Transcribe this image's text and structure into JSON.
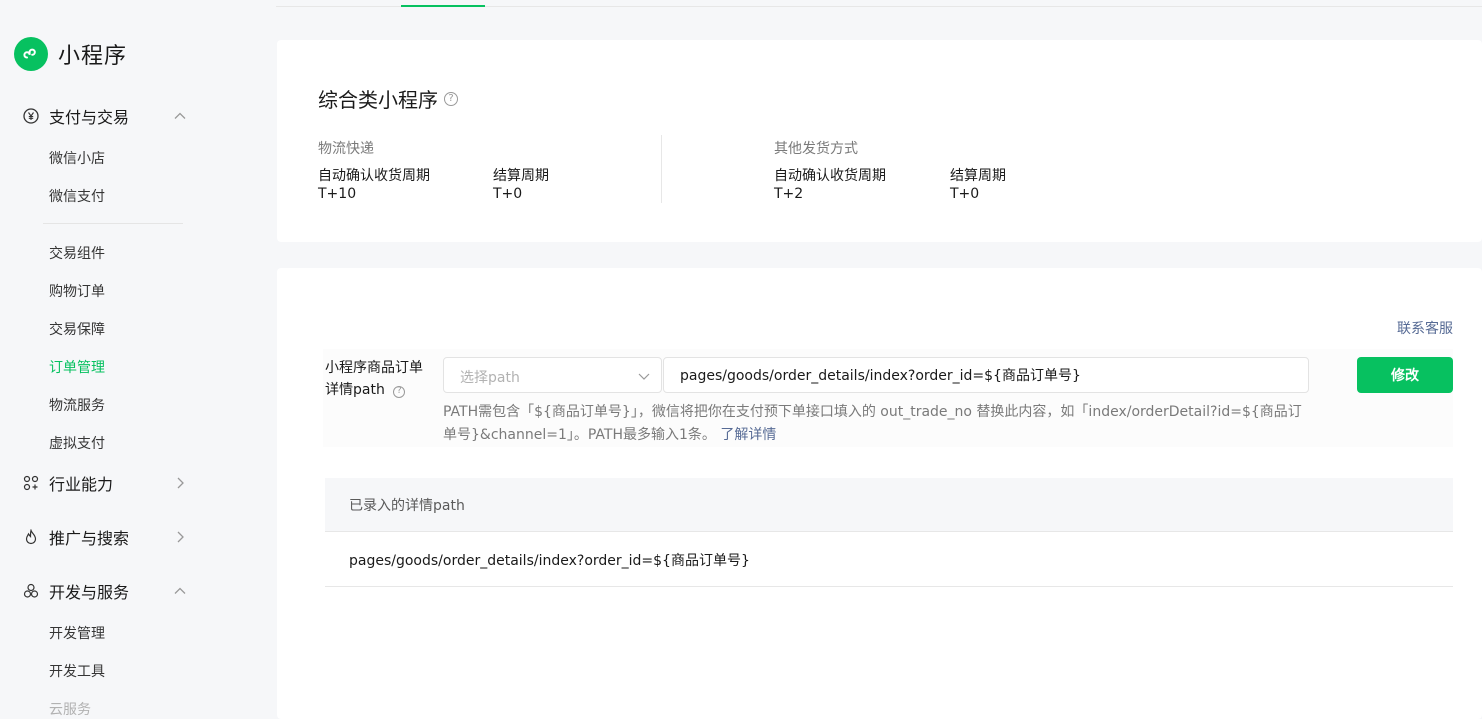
{
  "app": {
    "title": "小程序"
  },
  "sidebar": {
    "groups": [
      {
        "label": "支付与交易",
        "expanded": true,
        "icon": "yen-circle-icon"
      },
      {
        "label": "行业能力",
        "expanded": false,
        "icon": "industry-icon"
      },
      {
        "label": "推广与搜索",
        "expanded": false,
        "icon": "flame-icon"
      },
      {
        "label": "开发与服务",
        "expanded": true,
        "icon": "dev-cluster-icon"
      }
    ],
    "items": [
      {
        "label": "微信小店"
      },
      {
        "label": "微信支付"
      },
      {
        "label": "交易组件"
      },
      {
        "label": "购物订单"
      },
      {
        "label": "交易保障"
      },
      {
        "label": "订单管理",
        "active": true
      },
      {
        "label": "物流服务"
      },
      {
        "label": "虚拟支付"
      },
      {
        "label": "开发管理"
      },
      {
        "label": "开发工具"
      },
      {
        "label": "云服务"
      }
    ]
  },
  "summary": {
    "title": "综合类小程序",
    "sections": [
      {
        "name": "物流快递",
        "fields": [
          {
            "label": "自动确认收货周期",
            "value": "T+10"
          },
          {
            "label": "结算周期",
            "value": "T+0"
          }
        ]
      },
      {
        "name": "其他发货方式",
        "fields": [
          {
            "label": "自动确认收货周期",
            "value": "T+2"
          },
          {
            "label": "结算周期",
            "value": "T+0"
          }
        ]
      }
    ]
  },
  "path_form": {
    "contact_link": "联系客服",
    "label": "小程序商品订单详情path",
    "select_placeholder": "选择path",
    "input_value": "pages/goods/order_details/index?order_id=${商品订单号}",
    "submit_label": "修改",
    "hint_text": "PATH需包含「${商品订单号}」，微信将把你在支付预下单接口填入的 out_trade_no 替换此内容，如「index/orderDetail?id=${商品订单号}&channel=1」。PATH最多输入1条。",
    "hint_link": "了解详情"
  },
  "table": {
    "header": "已录入的详情path",
    "rows": [
      "pages/goods/order_details/index?order_id=${商品订单号}"
    ]
  },
  "colors": {
    "brand": "#07c160",
    "link": "#576b95"
  }
}
